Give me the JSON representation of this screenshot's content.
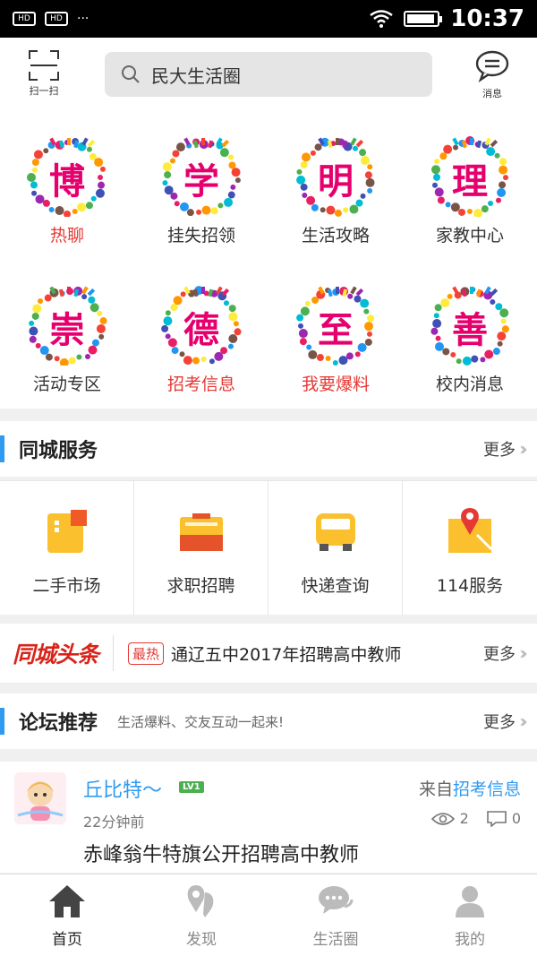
{
  "status_bar": {
    "time": "10:37",
    "sim1": "HD",
    "sim2": "HD",
    "dots": "···"
  },
  "header": {
    "scan_label": "扫一扫",
    "search_text": "民大生活圈",
    "message_label": "消息"
  },
  "grid": [
    {
      "char": "博",
      "label": "热聊",
      "label_color": "#e53935"
    },
    {
      "char": "学",
      "label": "挂失招领",
      "label_color": "#333333"
    },
    {
      "char": "明",
      "label": "生活攻略",
      "label_color": "#333333"
    },
    {
      "char": "理",
      "label": "家教中心",
      "label_color": "#333333"
    },
    {
      "char": "崇",
      "label": "活动专区",
      "label_color": "#333333"
    },
    {
      "char": "德",
      "label": "招考信息",
      "label_color": "#e53935"
    },
    {
      "char": "至",
      "label": "我要爆料",
      "label_color": "#e53935"
    },
    {
      "char": "善",
      "label": "校内消息",
      "label_color": "#333333"
    }
  ],
  "city_service": {
    "title": "同城服务",
    "more": "更多",
    "items": [
      {
        "label": "二手市场",
        "icon": "second-hand-icon"
      },
      {
        "label": "求职招聘",
        "icon": "briefcase-icon"
      },
      {
        "label": "快递查询",
        "icon": "car-icon"
      },
      {
        "label": "114服务",
        "icon": "map-pin-icon"
      }
    ]
  },
  "headline": {
    "logo": "同城头条",
    "tag": "最热",
    "text": "通辽五中2017年招聘高中教师",
    "more": "更多"
  },
  "forum": {
    "title": "论坛推荐",
    "subtitle": "生活爆料、交友互动一起来!",
    "more": "更多"
  },
  "post": {
    "user": "丘比特～",
    "level": "LV1",
    "from_prefix": "来自",
    "from_section": "招考信息",
    "time": "22分钟前",
    "views": "2",
    "comments": "0",
    "title": "赤峰翁牛特旗公开招聘高中教师"
  },
  "tabs": [
    {
      "label": "首页",
      "icon": "home-icon"
    },
    {
      "label": "发现",
      "icon": "discover-icon"
    },
    {
      "label": "生活圈",
      "icon": "chat-icon"
    },
    {
      "label": "我的",
      "icon": "user-icon"
    }
  ],
  "colors": {
    "accent": "#2f9af2",
    "red": "#e53935",
    "magenta": "#e6006e"
  }
}
